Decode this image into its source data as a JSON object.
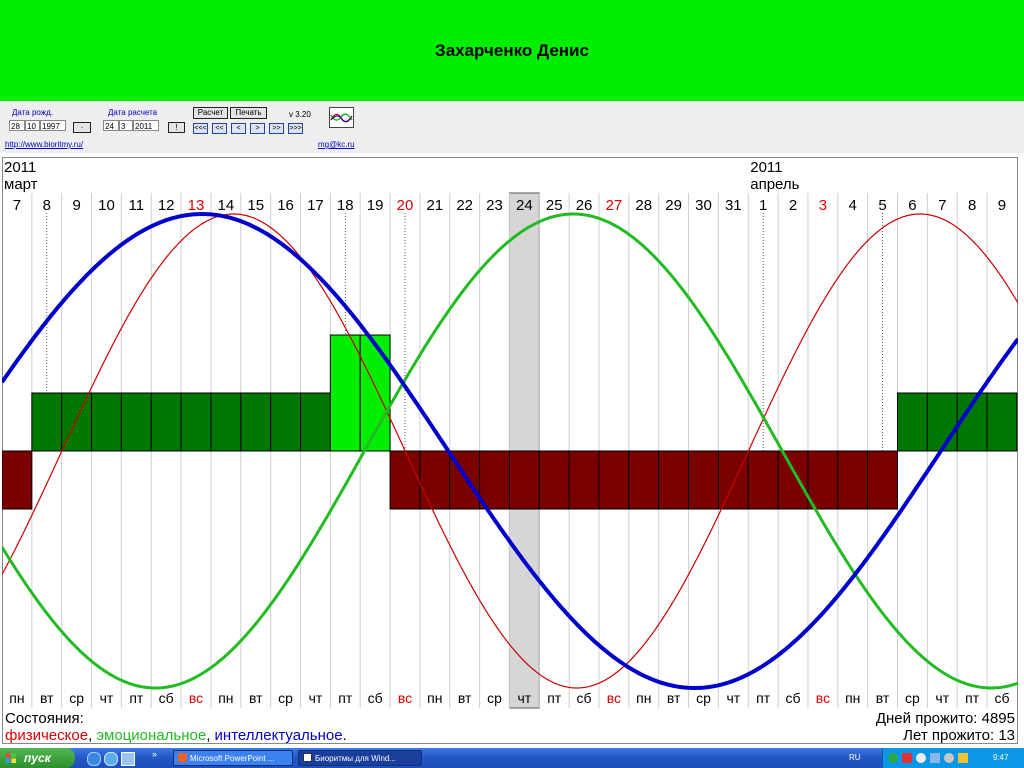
{
  "header": {
    "title": "Захарченко Денис"
  },
  "controls": {
    "birth_label": "Дата рожд.",
    "birth_day": "28",
    "birth_month": "10",
    "birth_year": "1997",
    "calc_label": "Дата расчета",
    "calc_day": "24",
    "calc_month": "3",
    "calc_year": "2011",
    "btn_dot": "·",
    "btn_bang": "!",
    "calc_button": "Расчет",
    "print_button": "Печать",
    "version": "v 3.20",
    "nav_labels": [
      "<<<",
      "<<",
      "<",
      ">",
      ">>",
      ">>>"
    ],
    "site_link": "http://www.bioritmy.ru/",
    "mail_link": "mg@kc.ru"
  },
  "chart_data": {
    "type": "line",
    "title": "Захарченко Денис",
    "start_day_label": "7",
    "days": [
      "7",
      "8",
      "9",
      "10",
      "11",
      "12",
      "13",
      "14",
      "15",
      "16",
      "17",
      "18",
      "19",
      "20",
      "21",
      "22",
      "23",
      "24",
      "25",
      "26",
      "27",
      "28",
      "29",
      "30",
      "31",
      "1",
      "2",
      "3",
      "4",
      "5",
      "6",
      "7",
      "8",
      "9"
    ],
    "weekdays": [
      "пн",
      "вт",
      "ср",
      "чт",
      "пт",
      "сб",
      "вс",
      "пн",
      "вт",
      "ср",
      "чт",
      "пт",
      "сб",
      "вс",
      "пн",
      "вт",
      "ср",
      "чт",
      "пт",
      "сб",
      "вс",
      "пн",
      "вт",
      "ср",
      "чт",
      "пт",
      "сб",
      "вс",
      "пн",
      "вт",
      "ср",
      "чт",
      "пт",
      "сб"
    ],
    "red_days": [
      6,
      13,
      20,
      27
    ],
    "dotted_days": [
      1,
      11,
      13,
      25,
      29
    ],
    "today_index": 17,
    "month_labels": [
      {
        "index": 0,
        "year": "2011",
        "month": "март"
      },
      {
        "index": 25,
        "year": "2011",
        "month": "апрель"
      }
    ],
    "series": [
      {
        "key": "physical",
        "color": "#cc0000",
        "period": 23,
        "values": [
          -0.4,
          -0.136,
          0.136,
          0.4,
          0.631,
          0.817,
          0.942,
          0.998,
          0.979,
          0.888,
          0.731,
          0.52,
          0.27,
          0.0,
          -0.27,
          -0.52,
          -0.731,
          -0.888,
          -0.979,
          -0.998,
          -0.942,
          -0.817,
          -0.631,
          -0.4,
          -0.136,
          0.136,
          0.4,
          0.631,
          0.817,
          0.942,
          0.998,
          0.979,
          0.888,
          0.731
        ]
      },
      {
        "key": "emotional",
        "color": "#22bb22",
        "period": 28,
        "values": [
          -0.505,
          -0.722,
          -0.873,
          -0.987,
          -1.0,
          -0.959,
          -0.843,
          -0.668,
          -0.444,
          -0.198,
          0.062,
          0.317,
          0.551,
          0.747,
          0.89,
          0.973,
          0.991,
          0.945,
          0.837,
          0.673,
          0.462,
          0.219,
          -0.039,
          -0.295,
          -0.532,
          -0.733,
          -0.883,
          -0.971,
          -0.993,
          -0.949,
          -0.842,
          -0.68,
          -0.47,
          -0.226
        ]
      },
      {
        "key": "intellectual",
        "color": "#0000cc",
        "period": 33,
        "values": [
          0.38,
          0.575,
          0.734,
          0.86,
          0.95,
          0.995,
          0.994,
          0.949,
          0.859,
          0.731,
          0.57,
          0.38,
          0.175,
          -0.04,
          -0.253,
          -0.451,
          -0.628,
          -0.777,
          -0.887,
          -0.958,
          -0.995,
          -0.99,
          -0.942,
          -0.855,
          -0.731,
          -0.575,
          -0.392,
          -0.19,
          0.022,
          0.234,
          0.434,
          0.61,
          0.757,
          0.872
        ]
      }
    ],
    "condition_bars": [
      -1,
      1,
      1,
      1,
      1,
      1,
      1,
      1,
      1,
      1,
      1,
      2,
      2,
      -1,
      -1,
      -1,
      -1,
      -1,
      -1,
      -1,
      -1,
      -1,
      -1,
      -1,
      -1,
      -1,
      -1,
      -1,
      -1,
      -1,
      1,
      1,
      1,
      1
    ],
    "legend_prefix": "Состояния:",
    "legend_physical": "физическое",
    "legend_sep1": ", ",
    "legend_emotional": "эмоциональное",
    "legend_sep2": ", ",
    "legend_intellectual": "интеллектуальное",
    "legend_end": ".",
    "days_lived": "Дней прожито: 4895",
    "years_lived": "Лет прожито: 13"
  },
  "taskbar": {
    "start_label": "пуск",
    "item1": "Microsoft PowerPoint ...",
    "item2": "Биоритмы для Wind...",
    "lang": "RU",
    "clock": "9:47"
  }
}
